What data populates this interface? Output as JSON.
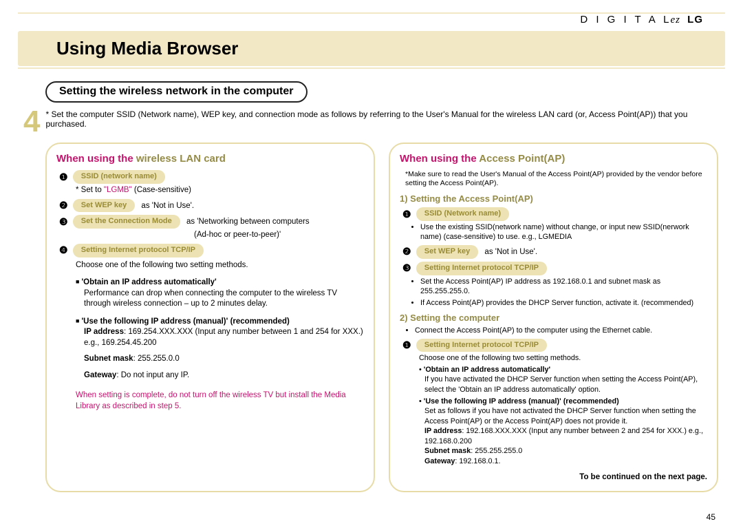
{
  "brand": {
    "digital": "D I G I T A L",
    "ez": "ez",
    "lg": "LG"
  },
  "title": "Using Media Browser",
  "subsection": "Setting the wireless network in the computer",
  "stepNum": "4",
  "stepText": "* Set the computer SSID (Network name), WEP key, and connection mode as follows by referring to the User's Manual for the wireless LAN card (or, Access Point(AP)) that you purchased.",
  "left": {
    "title_a": "When using the ",
    "title_b": "wireless LAN card",
    "i1_pill": "SSID (network name)",
    "i1_text_a": "* Set to ",
    "i1_text_b": "\"LGMB\"",
    "i1_text_c": " (Case-sensitive)",
    "i2_pill": "Set WEP key",
    "i2_after": "as 'Not in Use'.",
    "i3_pill": "Set the Connection Mode",
    "i3_after_a": "as 'Networking between computers",
    "i3_after_b": "(Ad-hoc or peer-to-peer)'",
    "i4_pill": "Setting Internet protocol TCP/IP",
    "i4_text": "Choose one of the following two setting methods.",
    "m1_h": "'Obtain an IP address automatically'",
    "m1_t": "Performance can drop when connecting the computer to the wireless TV through wireless connection – up to 2 minutes delay.",
    "m2_h": "'Use the following IP address (manual)' (recommended)",
    "m2_ip_a": "IP address",
    "m2_ip_b": ": 169.254.XXX.XXX (Input any number between 1 and 254 for XXX.) e.g., 169.254.45.200",
    "m2_sn_a": "Subnet mask",
    "m2_sn_b": ": 255.255.0.0",
    "m2_gw_a": "Gateway",
    "m2_gw_b": ": Do not input any IP.",
    "warn": "When setting is complete, do not turn off the wireless TV but install the Media Library as described in step 5."
  },
  "right": {
    "title_a": "When using the ",
    "title_b": "Access Point(AP)",
    "note": "*Make sure to read the User's Manual of the Access Point(AP) provided by the vendor before setting the Access Point(AP).",
    "s1": "1) Setting the Access Point(AP)",
    "r1_pill": "SSID (Network name)",
    "r1_b1": "Use the existing SSID(network name) without change, or input new SSID(nerwork name) (case-sensitive) to use. e.g., LGMEDIA",
    "r2_pill": "Set WEP key",
    "r2_after": "as 'Not in Use'.",
    "r3_pill": "Setting Internet protocol TCP/IP",
    "r3_b1": "Set the Access Point(AP) IP address as 192.168.0.1 and subnet mask as 255.255.255.0.",
    "r3_b2": "If Access Point(AP) provides the DHCP Server function, activate it. (recommended)",
    "s2": "2) Setting the computer",
    "s2_b": "Connect the Access Point(AP) to the computer using the Ethernet cable.",
    "r4_pill": "Setting Internet protocol TCP/IP",
    "r4_txt": "Choose one of the following two setting methods.",
    "r4_m1h": "'Obtain an IP address automatically'",
    "r4_m1t": "If you have activated the DHCP Server function when setting the Access Point(AP), select the 'Obtain an IP address automatically' option.",
    "r4_m2h": "'Use the following IP address (manual)' (recommended)",
    "r4_m2t": "Set as follows if you have not activated the DHCP Server function when setting the Access Point(AP) or the Access Point(AP) does not provide it.",
    "r4_ip_a": "IP address",
    "r4_ip_b": ": 192.168.XXX.XXX (Input any number between 2 and 254 for XXX.) e.g., 192.168.0.200",
    "r4_sn_a": "Subnet mask",
    "r4_sn_b": ": 255.255.255.0",
    "r4_gw_a": "Gateway",
    "r4_gw_b": ": 192.168.0.1.",
    "cont": "To be continued on the next page."
  },
  "pageNum": "45"
}
